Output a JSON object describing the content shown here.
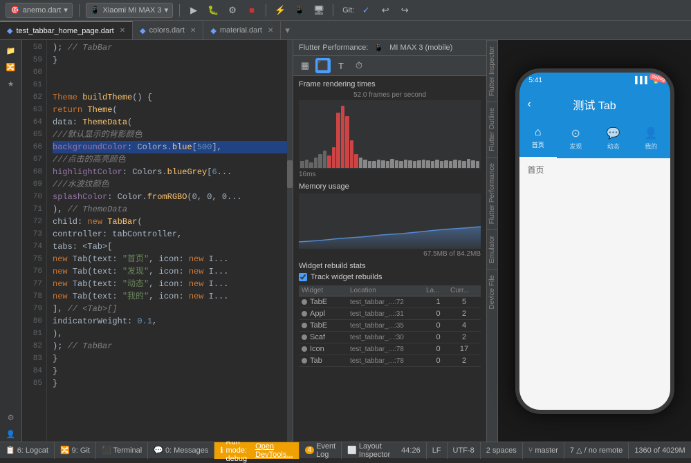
{
  "toolbar": {
    "project_dropdown": "anemo.dart",
    "device_dropdown": "Xiaomi MI MAX 3",
    "git_label": "Git:"
  },
  "file_tabs": [
    {
      "name": "test_tabbar_home_page.dart",
      "active": true,
      "icon": "dart"
    },
    {
      "name": "colors.dart",
      "active": false,
      "icon": "dart"
    },
    {
      "name": "material.dart",
      "active": false,
      "icon": "dart"
    }
  ],
  "code": {
    "lines": [
      {
        "num": 58,
        "text": "    ); // TabBar"
      },
      {
        "num": 59,
        "text": "  }"
      },
      {
        "num": 60,
        "text": ""
      },
      {
        "num": 61,
        "text": ""
      },
      {
        "num": 62,
        "text": "  Theme buildTheme() {"
      },
      {
        "num": 63,
        "text": "    return Theme("
      },
      {
        "num": 64,
        "text": "      data: ThemeData("
      },
      {
        "num": 65,
        "text": "        ///默认显示的背影颜色"
      },
      {
        "num": 66,
        "text": "        backgroundColor: Colors.blue[500],"
      },
      {
        "num": 67,
        "text": "        ///点击的高亮颜色"
      },
      {
        "num": 68,
        "text": "        highlightColor: Colors.blueGrey[6..."
      },
      {
        "num": 69,
        "text": "        ///水波纹颜色"
      },
      {
        "num": 70,
        "text": "        splashColor: Color.fromRGBO(0, 0, 0..."
      },
      {
        "num": 71,
        "text": "      ), // ThemeData"
      },
      {
        "num": 72,
        "text": "      child: new TabBar("
      },
      {
        "num": 73,
        "text": "        controller: tabController,"
      },
      {
        "num": 74,
        "text": "        tabs: <Tab>["
      },
      {
        "num": 75,
        "text": "          new Tab(text: \"首页\", icon: new I..."
      },
      {
        "num": 76,
        "text": "          new Tab(text: \"发现\", icon: new I..."
      },
      {
        "num": 77,
        "text": "          new Tab(text: \"动态\", icon: new I..."
      },
      {
        "num": 78,
        "text": "          new Tab(text: \"我的\", icon: new I..."
      },
      {
        "num": 79,
        "text": "        ], // <Tab>[]"
      },
      {
        "num": 80,
        "text": "        indicatorWeight: 0.1,"
      },
      {
        "num": 81,
        "text": "      ),"
      },
      {
        "num": 82,
        "text": "    ); // TabBar"
      },
      {
        "num": 83,
        "text": "  }"
      },
      {
        "num": 84,
        "text": "  }"
      },
      {
        "num": 85,
        "text": "}"
      }
    ]
  },
  "perf_panel": {
    "title": "Flutter Performance:",
    "device": "MI MAX 3 (mobile)",
    "frame_section": {
      "title": "Frame rendering times",
      "fps_label": "52.0 frames per second",
      "time_label": "16ms"
    },
    "memory_section": {
      "title": "Memory usage",
      "usage_label": "67.5MB of 84.2MB"
    },
    "rebuild_section": {
      "title": "Widget rebuild stats",
      "track_label": "Track widget rebuilds",
      "table": {
        "headers": [
          "Widget",
          "Location",
          "La...",
          "Curr..."
        ],
        "rows": [
          {
            "widget": "TabE",
            "location": "test_tabbar_...:72",
            "last": 1,
            "current": 5
          },
          {
            "widget": "Appl",
            "location": "test_tabbar_...:31",
            "last": 0,
            "current": 2
          },
          {
            "widget": "TabE",
            "location": "test_tabbar_...:35",
            "last": 0,
            "current": 4
          },
          {
            "widget": "Scaf",
            "location": "test_tabbar_...:30",
            "last": 0,
            "current": 2
          },
          {
            "widget": "Icon",
            "location": "test_tabbar_...:78",
            "last": 0,
            "current": 17
          },
          {
            "widget": "Tab",
            "location": "test_tabbar_...:78",
            "last": 0,
            "current": 2
          }
        ]
      }
    }
  },
  "right_tabs": [
    "Flutter Inspector",
    "Flutter Outline",
    "Flutter Performance",
    "Emulator",
    "Device File"
  ],
  "mobile_preview": {
    "status_bar": {
      "time": "5:41",
      "wifi": "▌▌▌",
      "battery": "🔋"
    },
    "app_bar_title": "测试 Tab",
    "tabs": [
      {
        "label": "首页",
        "icon": "⌂",
        "active": true
      },
      {
        "label": "发现",
        "icon": "☗",
        "active": false
      },
      {
        "label": "动态",
        "icon": "💬",
        "active": false
      },
      {
        "label": "我的",
        "icon": "👤",
        "active": false
      }
    ],
    "content_label": "首页"
  },
  "status_bar": {
    "branch": "6: Logcat",
    "git": "9: Git",
    "terminal": "Terminal",
    "messages": "0: Messages",
    "run_mode": "Run mode: debug",
    "devtools": "Open DevTools...",
    "position": "44:26",
    "encoding": "LF",
    "charset": "UTF-8",
    "indent": "2 spaces",
    "git_branch": "master",
    "event_count": "4",
    "event_label": "Event Log",
    "layout": "Layout Inspector",
    "git_status": "7 △ / no remote",
    "line_count": "1360 of 4029M"
  }
}
